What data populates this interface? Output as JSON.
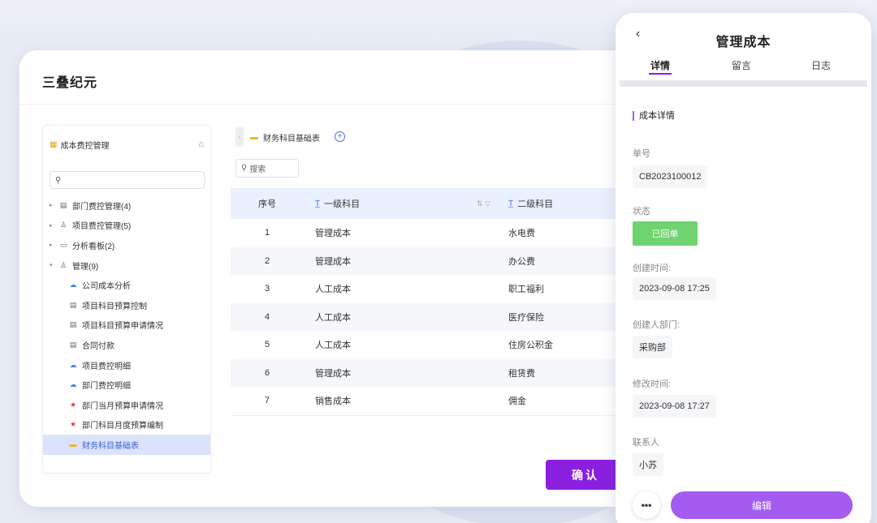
{
  "app": {
    "brand": "三叠纪元"
  },
  "sidebar": {
    "title": "成本费控管理",
    "title_icon": "building-icon",
    "home_icon": "home-icon",
    "search_icon": "search-icon",
    "items": [
      {
        "label": "部门费控管理(4)",
        "icon": "database-icon",
        "level": 0,
        "caret": "▸"
      },
      {
        "label": "项目费控管理(5)",
        "icon": "users-icon",
        "level": 0,
        "caret": "▸"
      },
      {
        "label": "分析看板(2)",
        "icon": "folder-icon",
        "level": 0,
        "caret": "▸"
      },
      {
        "label": "管理(9)",
        "icon": "users-icon",
        "level": 0,
        "caret": "▾"
      },
      {
        "label": "公司成本分析",
        "icon": "cloud-icon",
        "level": 1
      },
      {
        "label": "项目科目预算控制",
        "icon": "document-icon",
        "level": 1
      },
      {
        "label": "项目科目预算申请情况",
        "icon": "document-icon",
        "level": 1
      },
      {
        "label": "合同付款",
        "icon": "document-icon",
        "level": 1
      },
      {
        "label": "项目费控明细",
        "icon": "cloud-icon",
        "level": 1
      },
      {
        "label": "部门费控明细",
        "icon": "cloud-icon",
        "level": 1
      },
      {
        "label": "部门当月预算申请情况",
        "icon": "star-icon",
        "level": 1
      },
      {
        "label": "部门科目月度预算编制",
        "icon": "star-icon",
        "level": 1
      },
      {
        "label": "财务科目基础表",
        "icon": "folder-icon",
        "level": 1,
        "active": true
      }
    ]
  },
  "main": {
    "tab_label": "财务科目基础表",
    "search_placeholder": "搜索",
    "columns": [
      "序号",
      "一级科目",
      "二级科目"
    ],
    "rows": [
      [
        "1",
        "管理成本",
        "水电费"
      ],
      [
        "2",
        "管理成本",
        "办公费"
      ],
      [
        "3",
        "人工成本",
        "职工福利"
      ],
      [
        "4",
        "人工成本",
        "医疗保险"
      ],
      [
        "5",
        "人工成本",
        "住房公积金"
      ],
      [
        "6",
        "管理成本",
        "租赁费"
      ],
      [
        "7",
        "销售成本",
        "佣金"
      ]
    ],
    "confirm_label": "确认"
  },
  "detail": {
    "title": "管理成本",
    "tabs": [
      "详情",
      "留言",
      "日志"
    ],
    "section_title": "成本详情",
    "fields": [
      {
        "label": "单号",
        "value": "CB2023100012"
      },
      {
        "label": "状态",
        "value": "已回单",
        "type": "status"
      },
      {
        "label": "创建时间:",
        "value": "2023-09-08 17:25"
      },
      {
        "label": "创建人部门:",
        "value": "采购部"
      },
      {
        "label": "修改时间:",
        "value": "2023-09-08 17:27"
      },
      {
        "label": "联系人",
        "value": "小苏"
      }
    ],
    "more_label": "•••",
    "edit_label": "编辑",
    "status_color": "#6fd36f",
    "accent_color": "#8a1fe0"
  }
}
